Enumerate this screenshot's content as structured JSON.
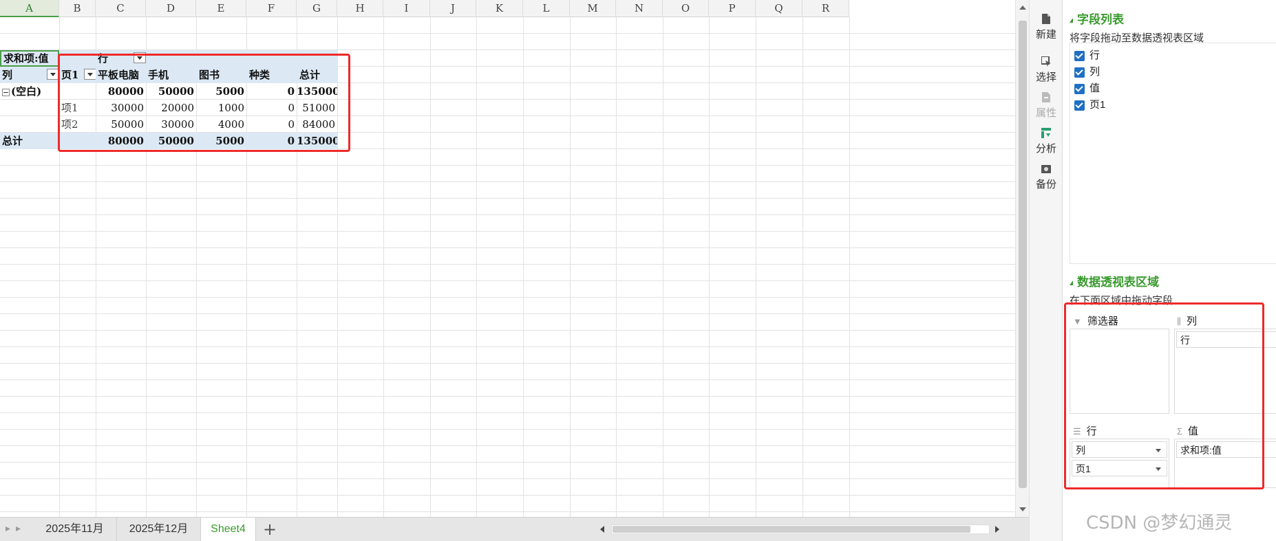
{
  "columns": [
    "A",
    "B",
    "C",
    "D",
    "E",
    "F",
    "G",
    "H",
    "I",
    "J",
    "K",
    "L",
    "M",
    "N",
    "O",
    "P",
    "Q",
    "R"
  ],
  "selected_column": "A",
  "pivot": {
    "sum_label": "求和项:值",
    "col_field": "行",
    "row_field": "列",
    "page_field": "页1",
    "col_headers": [
      "平板电脑",
      "手机",
      "图书",
      "种类",
      "总计"
    ],
    "group_label": "(空白)",
    "group_values": [
      "80000",
      "50000",
      "5000",
      "0",
      "135000"
    ],
    "items": [
      {
        "label": "项1",
        "values": [
          "30000",
          "20000",
          "1000",
          "0",
          "51000"
        ]
      },
      {
        "label": "项2",
        "values": [
          "50000",
          "30000",
          "4000",
          "0",
          "84000"
        ]
      }
    ],
    "total_label": "总计",
    "total_values": [
      "80000",
      "50000",
      "5000",
      "0",
      "135000"
    ]
  },
  "tabs": [
    "2025年11月",
    "2025年12月",
    "Sheet4"
  ],
  "active_tab": "Sheet4",
  "add_tab": "+",
  "side_tools": [
    {
      "label": "新建",
      "icon": "file-icon",
      "state": "normal"
    },
    {
      "label": "选择",
      "icon": "select-icon",
      "state": "normal"
    },
    {
      "label": "属性",
      "icon": "properties-icon",
      "state": "disabled"
    },
    {
      "label": "分析",
      "icon": "analysis-icon",
      "state": "active"
    },
    {
      "label": "备份",
      "icon": "backup-icon",
      "state": "normal"
    }
  ],
  "panel": {
    "field_list_title": "字段列表",
    "field_list_hint": "将字段拖动至数据透视表区域",
    "fields": [
      "行",
      "列",
      "值",
      "页1"
    ],
    "areas_title": "数据透视表区域",
    "areas_hint": "在下面区域中拖动字段",
    "filter_label": "筛选器",
    "columns_label": "列",
    "rows_label": "行",
    "values_label": "值",
    "columns_items": [
      "行"
    ],
    "rows_items": [
      "列",
      "页1"
    ],
    "values_items": [
      "求和项:值"
    ]
  },
  "watermark": "CSDN @梦幻通灵",
  "colors": {
    "accent": "#3a9b2e",
    "highlight": "#dce9f5",
    "callout": "#ee2a2a",
    "checkbox": "#1f6fc4"
  }
}
